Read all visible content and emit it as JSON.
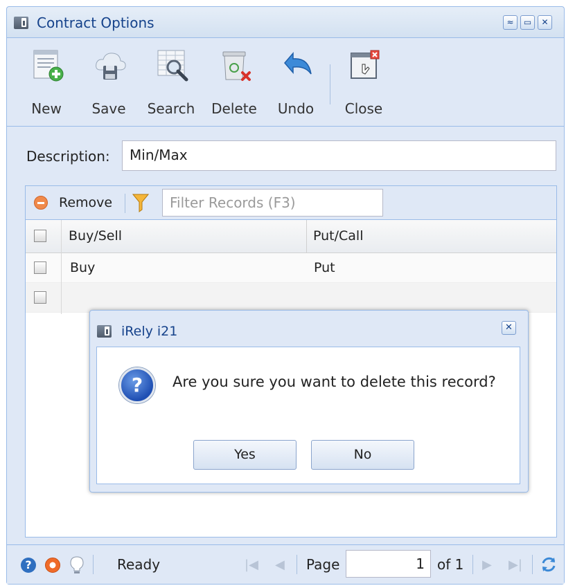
{
  "window": {
    "title": "Contract Options",
    "controls": {
      "collapse": "≈",
      "maximize": "▭",
      "close": "✕"
    }
  },
  "toolbar": {
    "new_label": "New",
    "save_label": "Save",
    "search_label": "Search",
    "delete_label": "Delete",
    "undo_label": "Undo",
    "close_label": "Close"
  },
  "form": {
    "description_label": "Description:",
    "description_value": "Min/Max"
  },
  "grid": {
    "remove_label": "Remove",
    "filter_placeholder": "Filter Records (F3)",
    "columns": [
      "Buy/Sell",
      "Put/Call"
    ],
    "rows": [
      {
        "buy_sell": "Buy",
        "put_call": "Put"
      },
      {
        "buy_sell": "",
        "put_call": ""
      }
    ]
  },
  "status": {
    "text": "Ready",
    "page_label": "Page",
    "page_value": "1",
    "of_label": "of 1"
  },
  "dialog": {
    "title": "iRely i21",
    "message": "Are you sure you want to delete this record?",
    "yes_label": "Yes",
    "no_label": "No",
    "close": "✕"
  },
  "icons": {
    "new": "new-document-icon",
    "save": "save-cloud-icon",
    "search": "search-icon",
    "delete": "recycle-bin-icon",
    "undo": "undo-arrow-icon",
    "close": "close-window-icon",
    "question": "question-icon"
  },
  "colors": {
    "panel_bg": "#dfe8f6",
    "border": "#99bbe8",
    "title_text": "#15428b"
  }
}
